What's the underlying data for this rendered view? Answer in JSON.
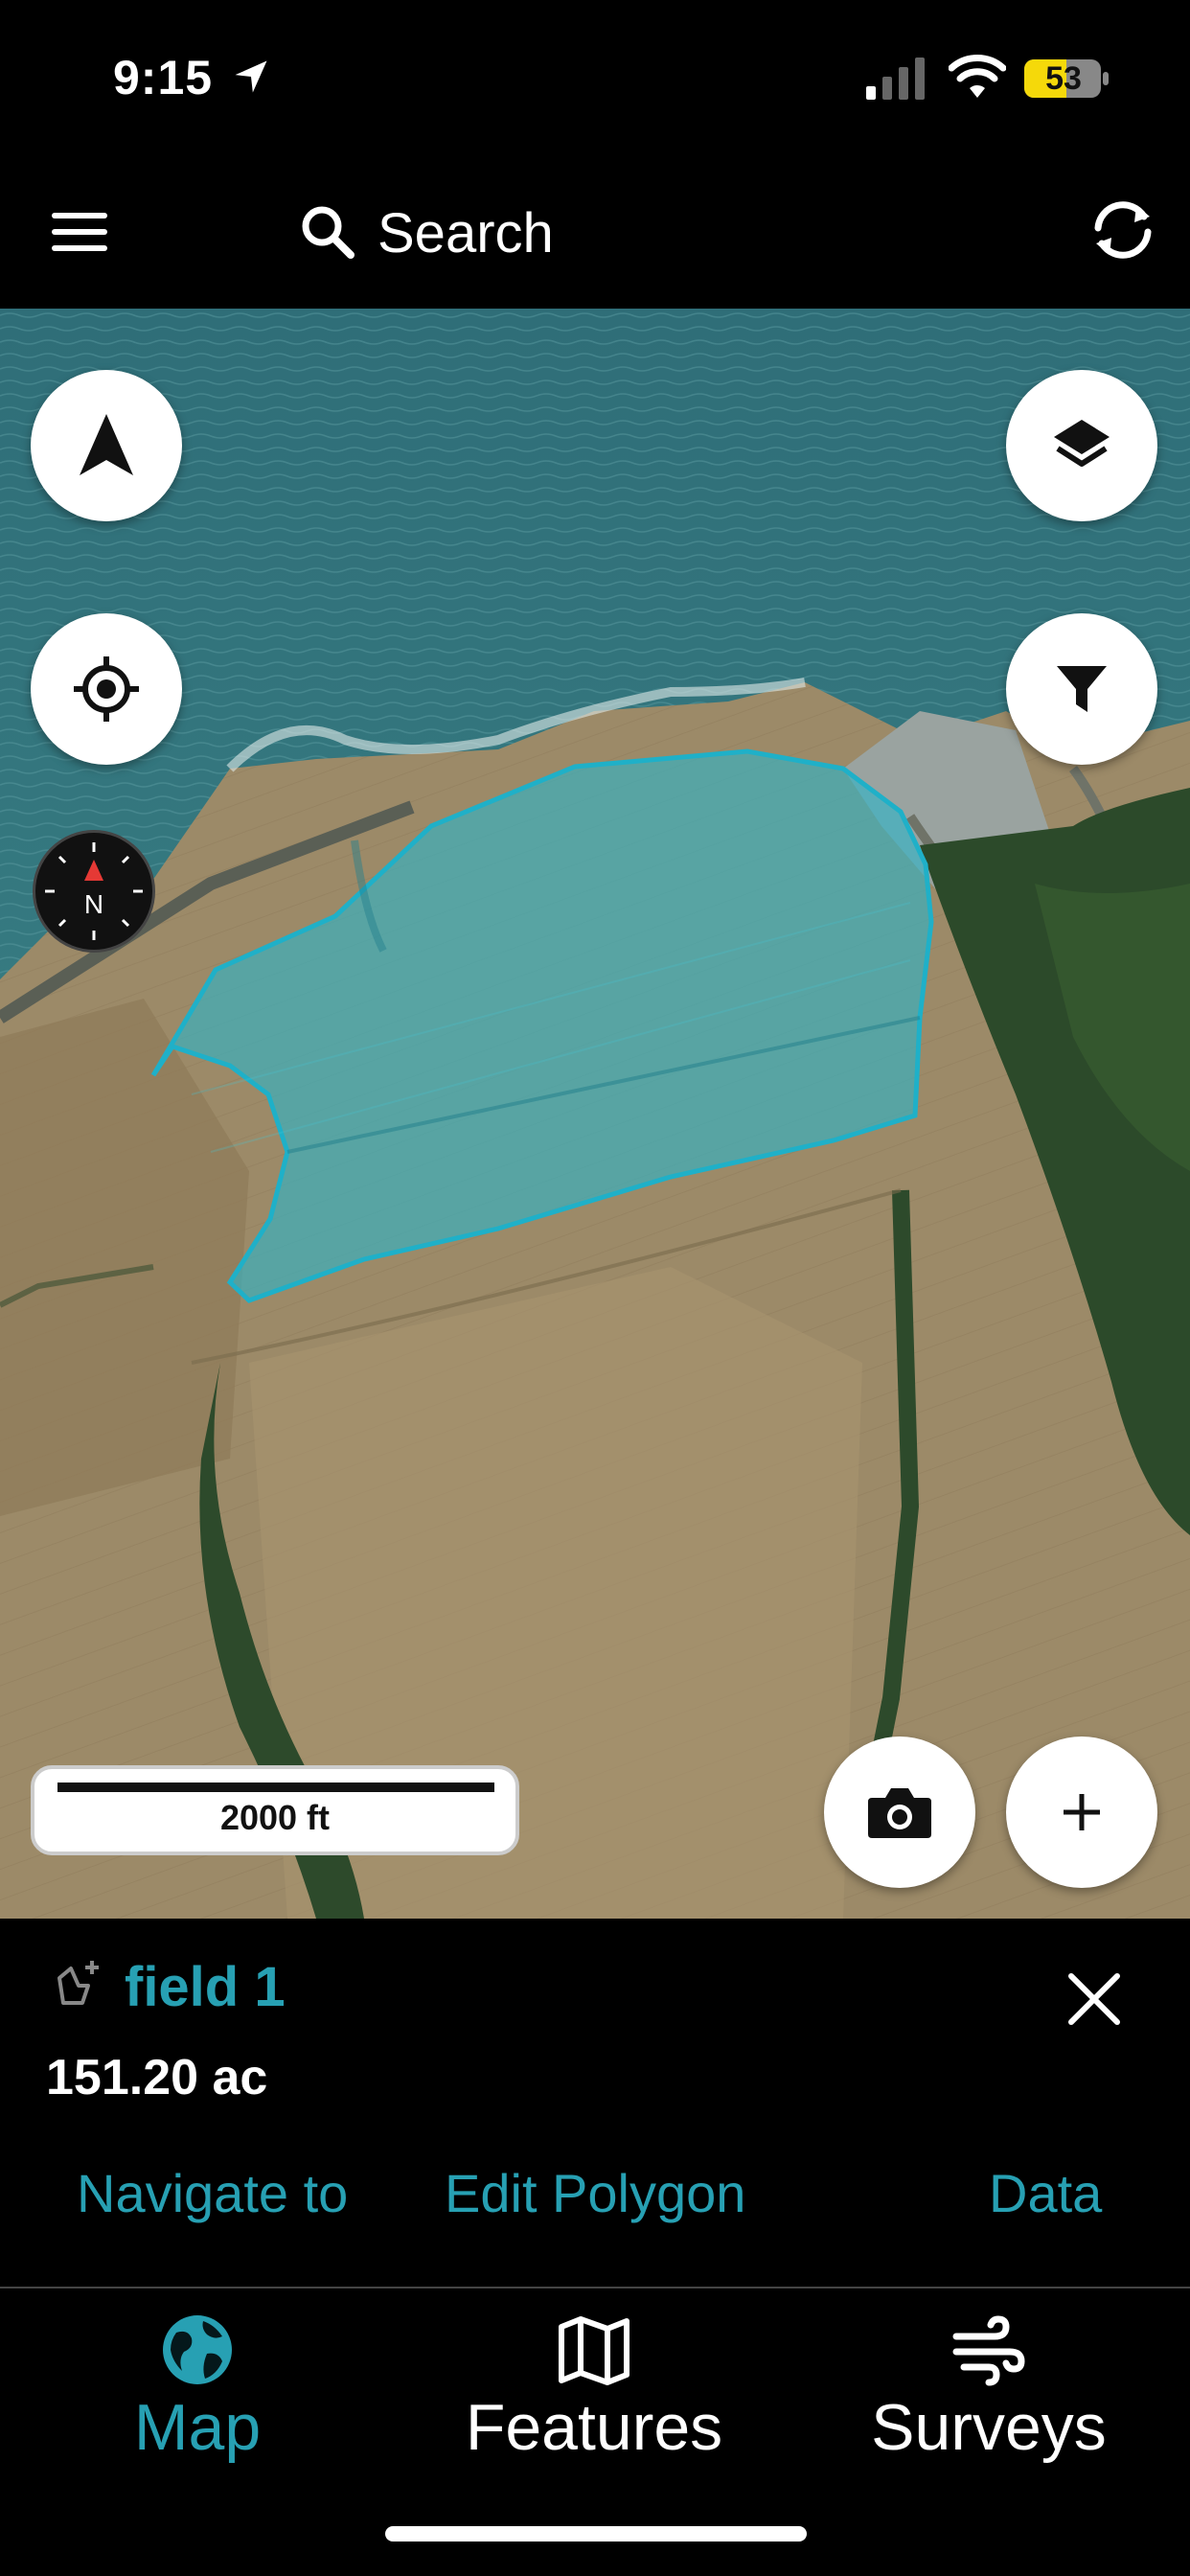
{
  "status_bar": {
    "time": "9:15",
    "battery": "53"
  },
  "topbar": {
    "search_label": "Search"
  },
  "map": {
    "scale_label": "2000 ft"
  },
  "feature": {
    "name": "field 1",
    "area": "151.20 ac",
    "actions": [
      "Navigate to",
      "Edit Polygon",
      "Data"
    ]
  },
  "tabs": [
    {
      "label": "Map",
      "icon": "globe-icon",
      "active": true
    },
    {
      "label": "Features",
      "icon": "map-book-icon",
      "active": false
    },
    {
      "label": "Surveys",
      "icon": "wind-icon",
      "active": false
    }
  ],
  "colors": {
    "accent": "#27a0b3",
    "polygon_fill": "#2fb5c8",
    "background": "#000000"
  }
}
